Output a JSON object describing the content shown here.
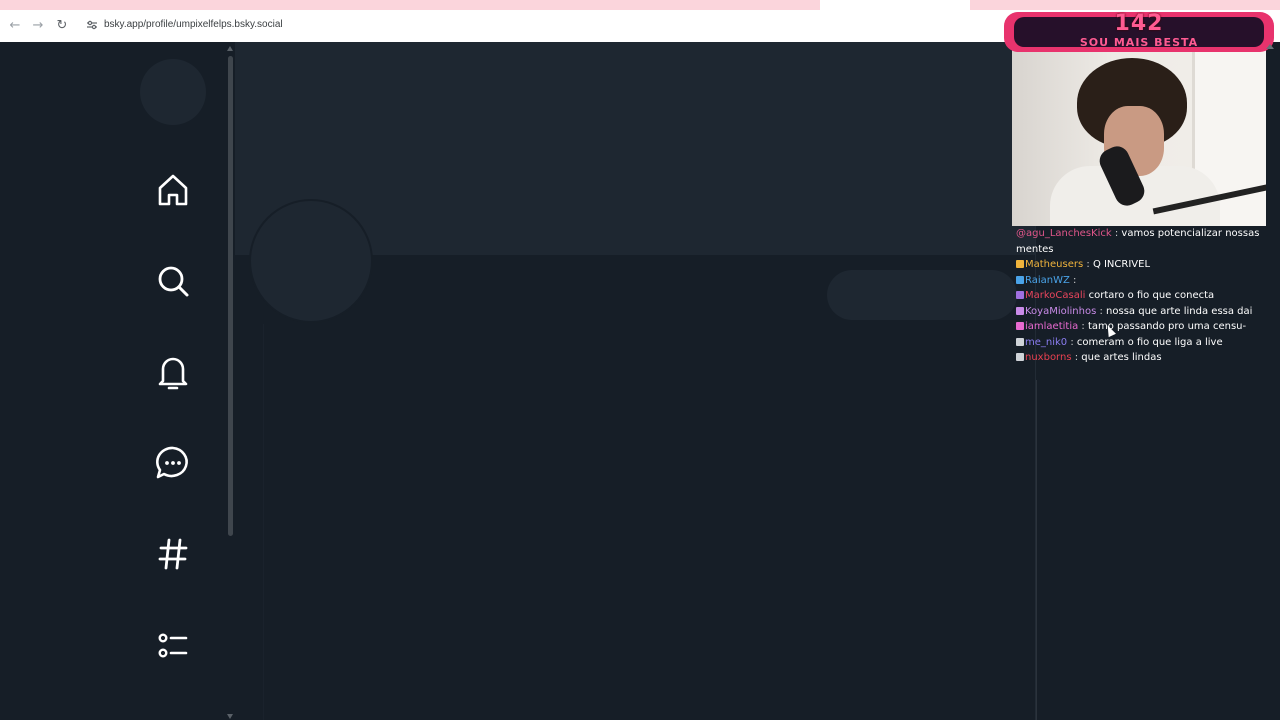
{
  "browser": {
    "url": "bsky.app/profile/umpixelfelps.bsky.social",
    "back_icon": "arrow-left-icon",
    "forward_icon": "arrow-right-icon",
    "reload_icon": "reload-icon"
  },
  "sidebar": {
    "items": [
      {
        "icon": "home-icon"
      },
      {
        "icon": "search-icon"
      },
      {
        "icon": "bell-icon"
      },
      {
        "icon": "chat-bubble-icon"
      },
      {
        "icon": "hashtag-icon"
      },
      {
        "icon": "list-icon"
      }
    ]
  },
  "webcam": {
    "count": "142",
    "subtitle": "SOU MAIS BESTA"
  },
  "chat": {
    "messages": [
      {
        "user": "@agu_LanchesKick",
        "color": "#e0568a",
        "sep": " : ",
        "text": "vamos potencializar nossas mentes"
      },
      {
        "user": "Matheusers",
        "color": "#f0b43c",
        "sep": " : ",
        "text": "Q INCRIVEL"
      },
      {
        "user": "RaianWZ",
        "color": "#4aa3e8",
        "sep": " : ",
        "text": ""
      },
      {
        "user": "MarkoCasali",
        "color": "#e8455c",
        "sep": "   ",
        "text": "cortaro o fio que conecta"
      },
      {
        "user": "KoyaMiolinhos",
        "color": "#c98be8",
        "sep": " : ",
        "text": "nossa que arte linda essa dai"
      },
      {
        "user": "iamlaetitia",
        "color": "#e86ad0",
        "sep": " : ",
        "text": "tamo passando pro uma censu-"
      },
      {
        "user": "me_nik0",
        "color": "#8a7cf0",
        "sep": " : ",
        "text": "comeram o fio que liga a live"
      },
      {
        "user": "nuxborns",
        "color": "#e84050",
        "sep": " : ",
        "text": "que artes lindas"
      }
    ]
  },
  "colors": {
    "background": "#161e27",
    "placeholder": "#1e2731",
    "accent": "#e8336d"
  }
}
